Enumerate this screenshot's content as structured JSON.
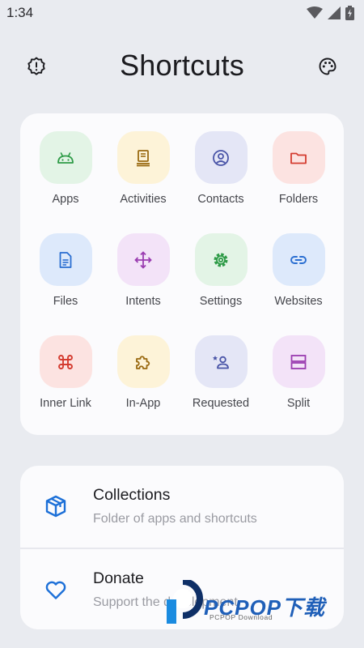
{
  "status_bar": {
    "time": "1:34"
  },
  "header": {
    "title": "Shortcuts"
  },
  "colors": {
    "background": "#e9ebf0",
    "card": "#fbfbfd",
    "accent_blue": "#1d70d8"
  },
  "grid": {
    "tiles": [
      {
        "label": "Apps",
        "icon": "android-icon",
        "bg": "#e3f4e6",
        "fg": "#2e9b47"
      },
      {
        "label": "Activities",
        "icon": "activity-icon",
        "bg": "#fdf3d8",
        "fg": "#9a6a12"
      },
      {
        "label": "Contacts",
        "icon": "contact-icon",
        "bg": "#e4e6f6",
        "fg": "#4a55a8"
      },
      {
        "label": "Folders",
        "icon": "folder-icon",
        "bg": "#fce3e1",
        "fg": "#d43c30"
      },
      {
        "label": "Files",
        "icon": "file-icon",
        "bg": "#dde9fb",
        "fg": "#2a6ed1"
      },
      {
        "label": "Intents",
        "icon": "move-arrows-icon",
        "bg": "#f3e3f8",
        "fg": "#9a3cb0"
      },
      {
        "label": "Settings",
        "icon": "gear-icon",
        "bg": "#e3f4e6",
        "fg": "#2e9b47"
      },
      {
        "label": "Websites",
        "icon": "link-icon",
        "bg": "#dde9fb",
        "fg": "#2a6ed1"
      },
      {
        "label": "Inner Link",
        "icon": "command-icon",
        "bg": "#fce3e1",
        "fg": "#d43c30"
      },
      {
        "label": "In-App",
        "icon": "puzzle-icon",
        "bg": "#fdf3d8",
        "fg": "#9a6a12"
      },
      {
        "label": "Requested",
        "icon": "person-star-icon",
        "bg": "#e4e6f6",
        "fg": "#4a55a8"
      },
      {
        "label": "Split",
        "icon": "split-icon",
        "bg": "#f3e3f8",
        "fg": "#9a3cb0"
      }
    ]
  },
  "list": {
    "items": [
      {
        "title": "Collections",
        "subtitle": "Folder of apps and shortcuts",
        "icon": "box-icon"
      },
      {
        "title": "Donate",
        "subtitle": "Support the development",
        "icon": "heart-icon"
      }
    ]
  },
  "watermark": {
    "brand": "PCPOP下载",
    "sub": "PCPOP Download"
  }
}
